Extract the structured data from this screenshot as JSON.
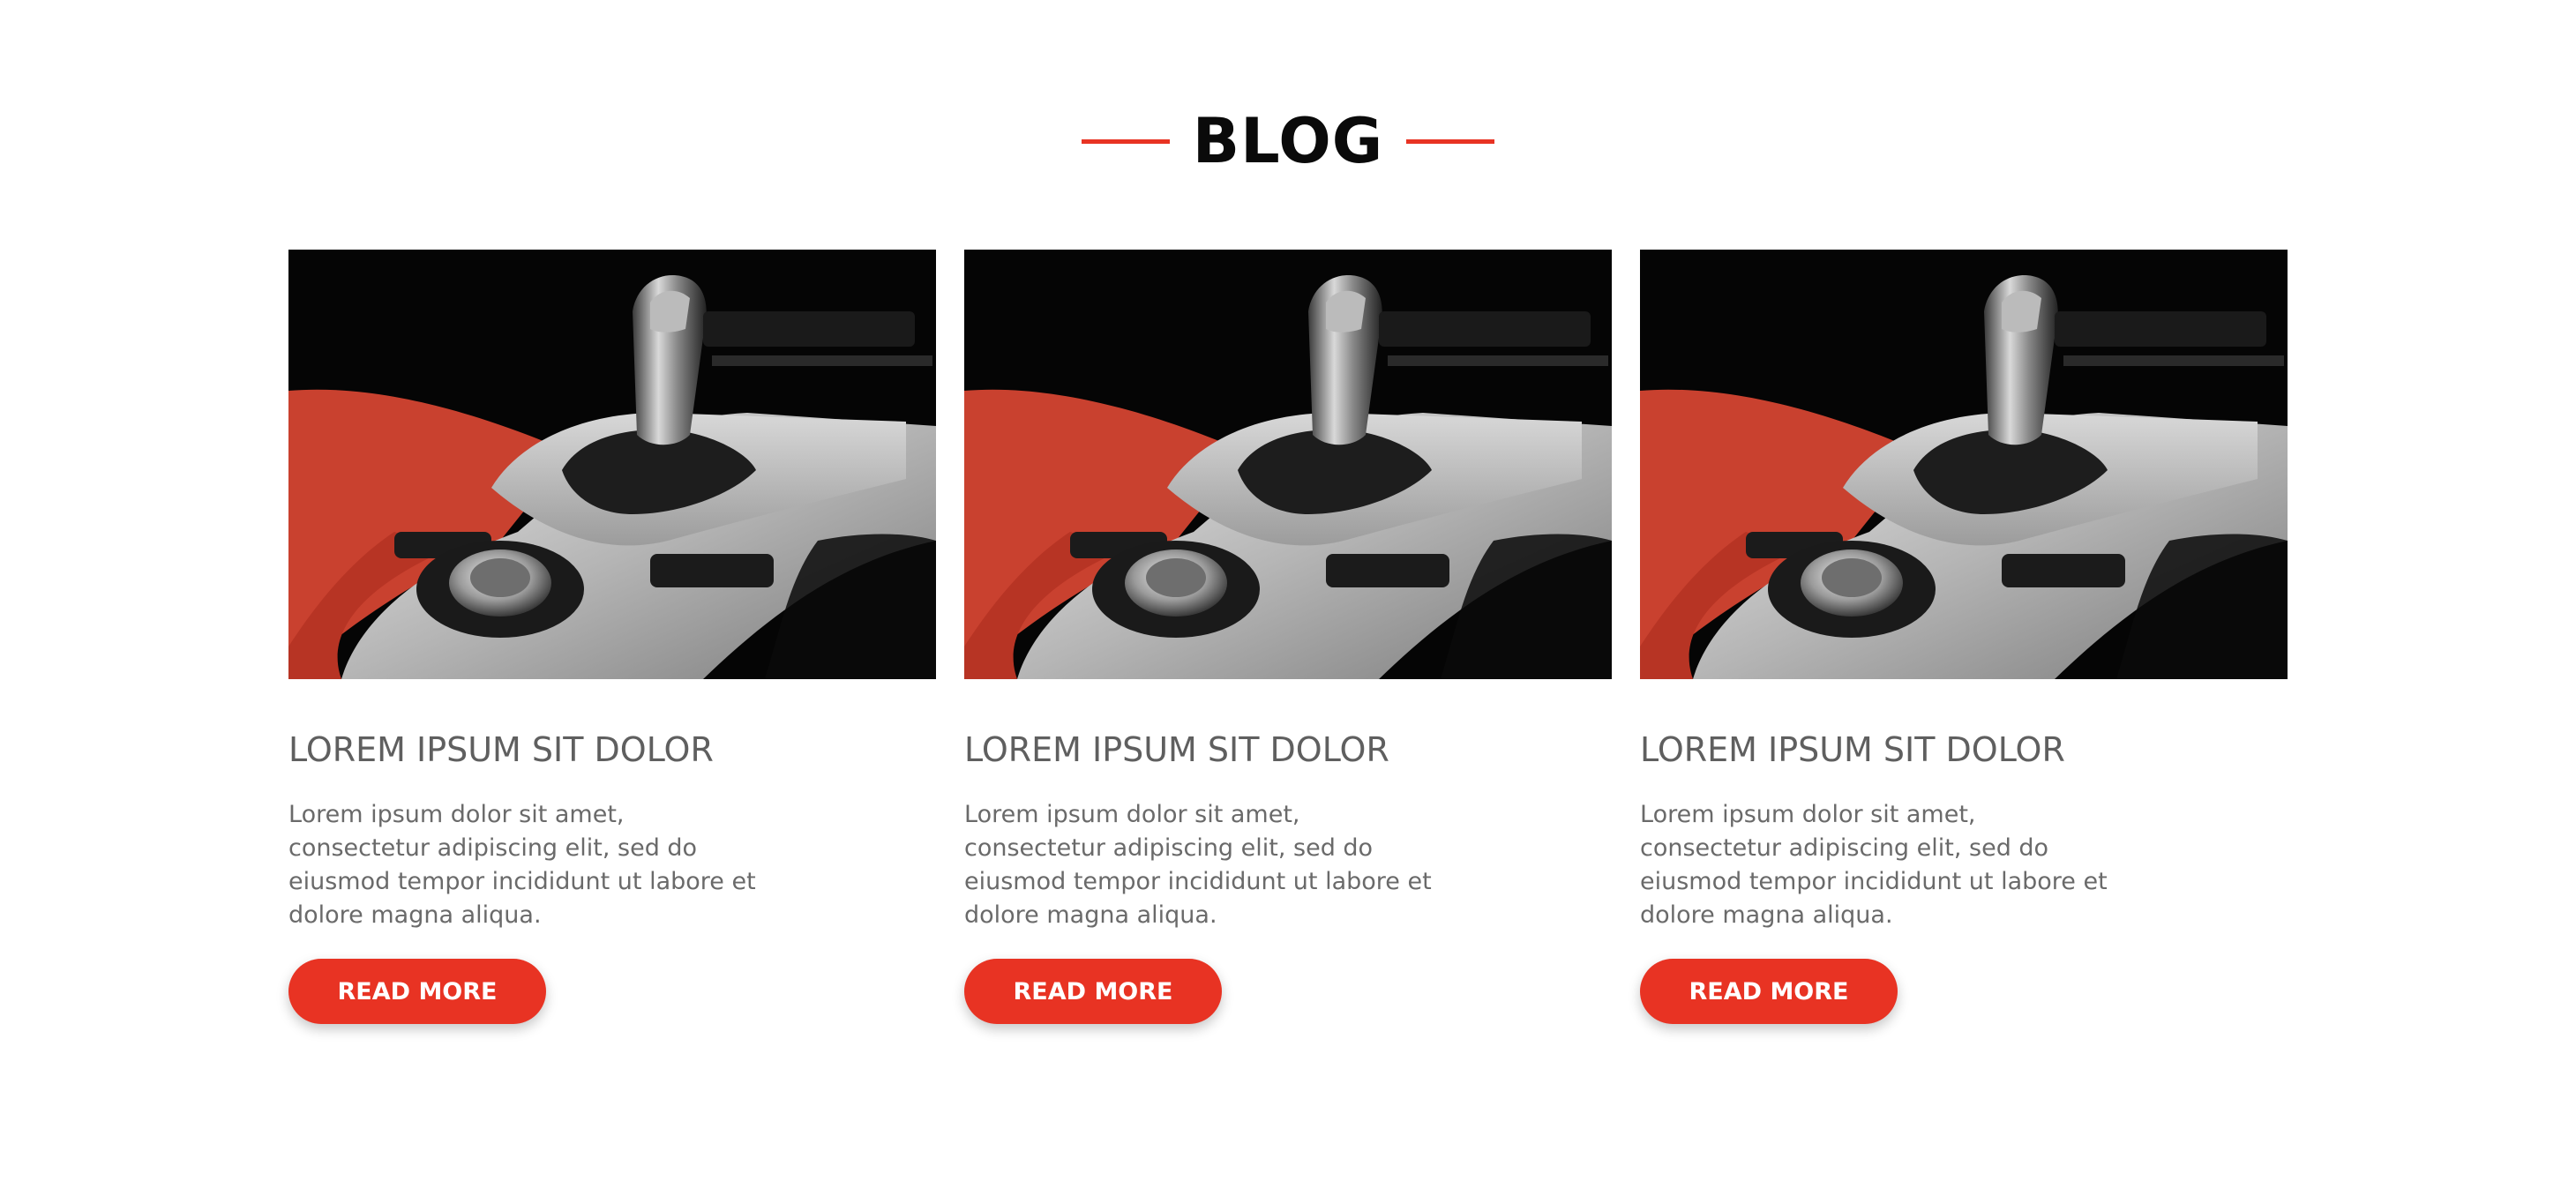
{
  "header": {
    "title": "BLOG",
    "accent_color": "#e83323"
  },
  "cards": [
    {
      "image": "car-gear-shifter-photo",
      "title": "LOREM IPSUM SIT DOLOR",
      "text": "Lorem ipsum dolor sit amet, consectetur adipiscing elit, sed do eiusmod tempor incididunt ut labore et dolore magna aliqua.",
      "button_label": "READ MORE"
    },
    {
      "image": "car-gear-shifter-photo",
      "title": "LOREM IPSUM SIT DOLOR",
      "text": "Lorem ipsum dolor sit amet, consectetur adipiscing elit, sed do eiusmod tempor incididunt ut labore et dolore magna aliqua.",
      "button_label": "READ MORE"
    },
    {
      "image": "car-gear-shifter-photo",
      "title": "LOREM IPSUM SIT DOLOR",
      "text": "Lorem ipsum dolor sit amet, consectetur adipiscing elit, sed do eiusmod tempor incididunt ut labore et dolore magna aliqua.",
      "button_label": "READ MORE"
    }
  ]
}
